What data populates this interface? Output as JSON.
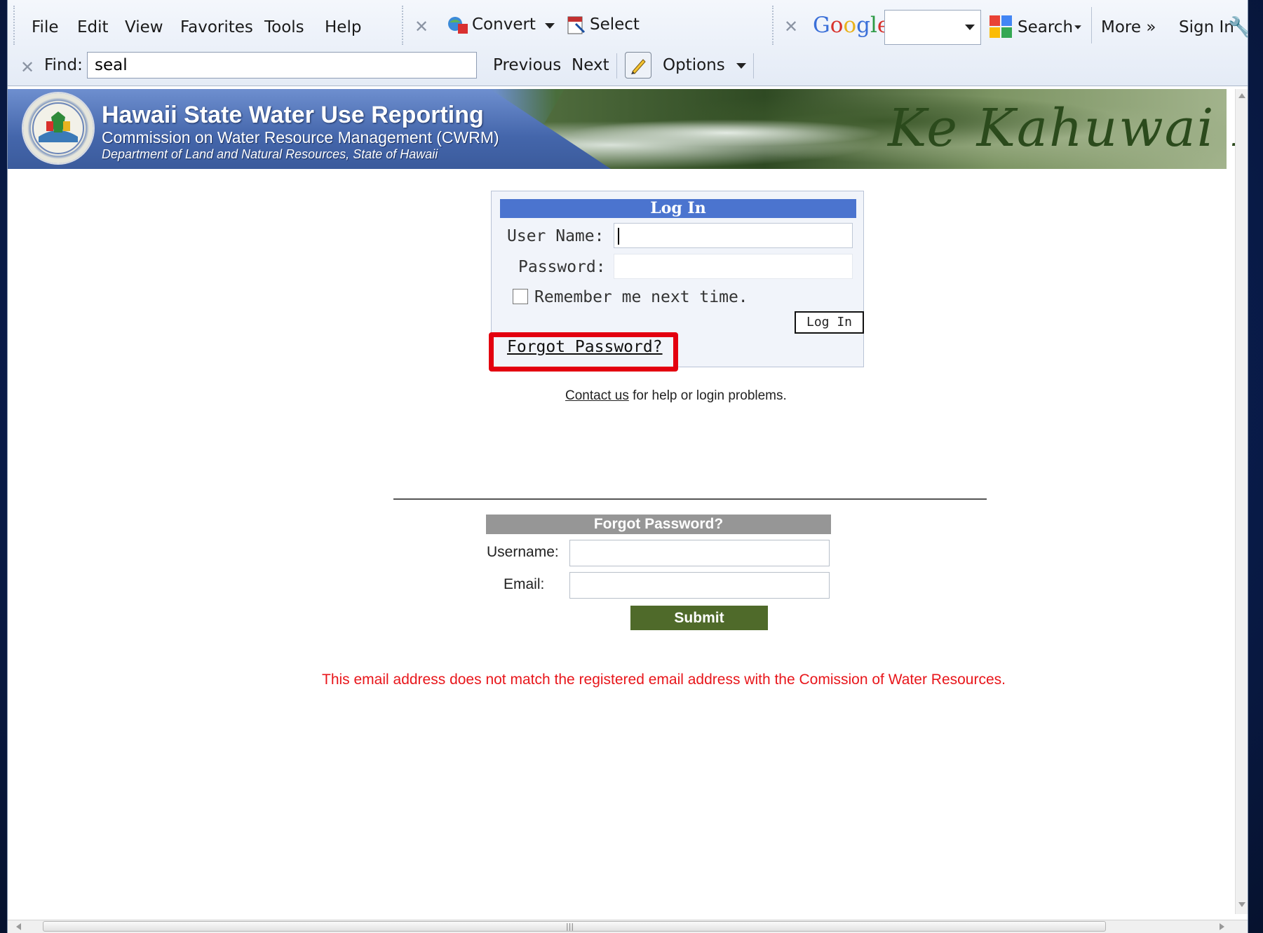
{
  "toolbar": {
    "menu": [
      "File",
      "Edit",
      "View",
      "Favorites",
      "Tools",
      "Help"
    ],
    "convert_label": "Convert",
    "select_label": "Select",
    "google_label": "Google",
    "search_label": "Search",
    "more_label": "More »",
    "signin_label": "Sign In"
  },
  "findbar": {
    "find_label": "Find:",
    "find_value": "seal",
    "previous_label": "Previous",
    "next_label": "Next",
    "options_label": "Options"
  },
  "banner": {
    "title": "Hawaii State Water Use Reporting",
    "subtitle": "Commission on Water Resource Management (CWRM)",
    "department": "Department of Land and Natural Resources, State of Hawaii",
    "script_text": "Ke Kahuwai P"
  },
  "login": {
    "header": "Log In",
    "username_label": "User Name:",
    "password_label": "Password:",
    "remember_label": "Remember me next time.",
    "button_label": "Log In",
    "forgot_link": "Forgot Password?"
  },
  "contact": {
    "link": "Contact us",
    "text": " for help or login problems."
  },
  "forgot": {
    "header": "Forgot Password?",
    "username_label": "Username:",
    "email_label": "Email:",
    "submit_label": "Submit"
  },
  "error_message": "This email address does not match the registered email address with the Comission of Water Resources.",
  "colors": {
    "highlight": "#e3000f",
    "login_header": "#4b74cf",
    "submit_bg": "#4f6a2a",
    "error": "#e8161b"
  }
}
